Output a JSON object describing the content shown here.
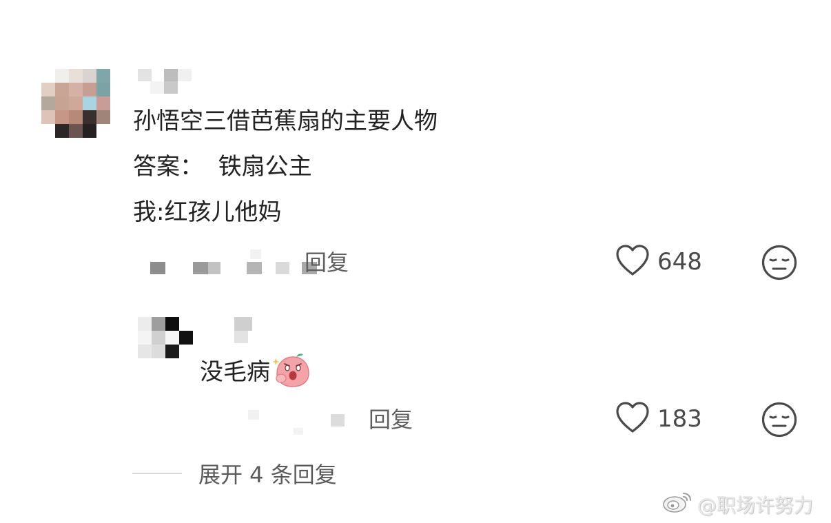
{
  "comments": [
    {
      "lines": [
        "孙悟空三借芭蕉扇的主要人物",
        "答案：  铁扇公主",
        "我:红孩儿他妈"
      ],
      "reply_label": "回复",
      "likes": "648",
      "reaction_icon": "expressionless-face-icon"
    },
    {
      "text": "没毛病",
      "emoji": "screaming-peach-emoji",
      "reply_label": "回复",
      "likes": "183",
      "reaction_icon": "expressionless-face-icon"
    }
  ],
  "expand_replies": {
    "label": "展开 4 条回复"
  },
  "watermark": {
    "text": "@职场许努力",
    "icon": "weibo-logo-icon"
  },
  "colors": {
    "text": "#222222",
    "secondary": "#5f5f5f",
    "icon_stroke": "#4a4a4a",
    "emoji_peach": "#f4a3a6"
  }
}
